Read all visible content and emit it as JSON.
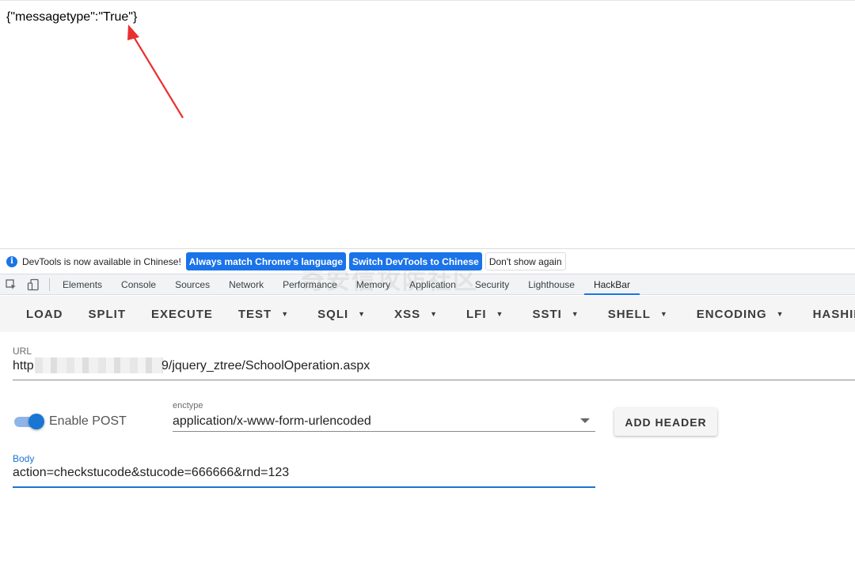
{
  "page": {
    "response_text": "{\"messagetype\":\"True\"}"
  },
  "infobar": {
    "message": "DevTools is now available in Chinese!",
    "always_match_label": "Always match Chrome's language",
    "switch_label": "Switch DevTools to Chinese",
    "dont_show_label": "Don't show again"
  },
  "devtools_tabs": [
    {
      "label": "Elements"
    },
    {
      "label": "Console"
    },
    {
      "label": "Sources"
    },
    {
      "label": "Network"
    },
    {
      "label": "Performance"
    },
    {
      "label": "Memory"
    },
    {
      "label": "Application"
    },
    {
      "label": "Security"
    },
    {
      "label": "Lighthouse"
    },
    {
      "label": "HackBar"
    }
  ],
  "watermark": "奇安信攻防社区",
  "hackbar": {
    "toolbar": {
      "load": "LOAD",
      "split": "SPLIT",
      "execute": "EXECUTE",
      "test": "TEST",
      "sqli": "SQLI",
      "xss": "XSS",
      "lfi": "LFI",
      "ssti": "SSTI",
      "shell": "SHELL",
      "encoding": "ENCODING",
      "hashing": "HASHING"
    },
    "url": {
      "label": "URL",
      "prefix": "http",
      "suffix": "9/jquery_ztree/SchoolOperation.aspx"
    },
    "enable_post": {
      "label": "Enable POST",
      "enabled": true
    },
    "enctype": {
      "label": "enctype",
      "value": "application/x-www-form-urlencoded"
    },
    "add_header_label": "ADD HEADER",
    "body": {
      "label": "Body",
      "value": "action=checkstucode&stucode=666666&rnd=123"
    }
  },
  "colors": {
    "accent": "#1a73e8",
    "arrow": "#e8312f",
    "toggle": "#1976d2"
  }
}
